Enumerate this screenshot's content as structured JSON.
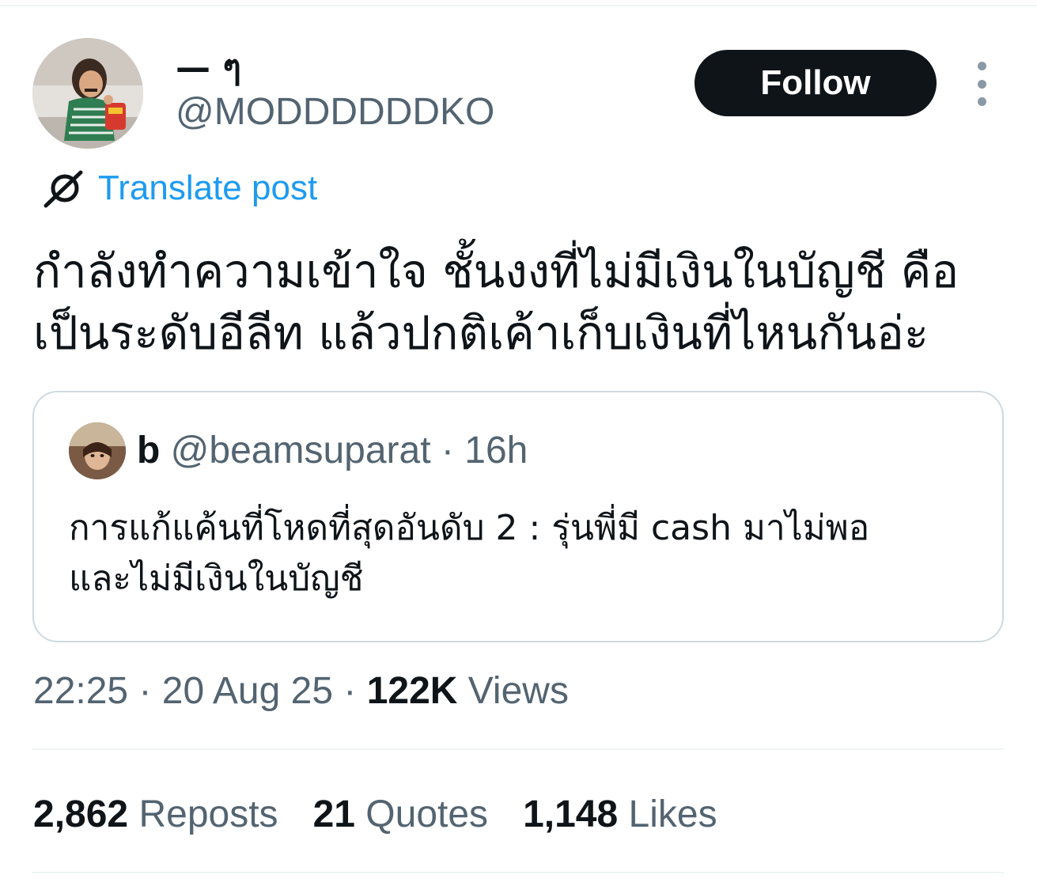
{
  "author": {
    "display_name": "— ๆ",
    "handle": "@MODDDDDDKO"
  },
  "actions": {
    "follow_label": "Follow",
    "more_icon": "more-vertical-icon"
  },
  "translate": {
    "icon": "globe-slash-icon",
    "label": "Translate post"
  },
  "tweet": {
    "text": "กำลังทำความเข้าใจ ชั้นงงที่ไม่มีเงินในบัญชี คือ\nเป็นระดับอีลีท แล้วปกติเค้าเก็บเงินที่ไหนกันอ่ะ"
  },
  "quote": {
    "name": "b",
    "handle": "@beamsuparat",
    "separator": "·",
    "time": "16h",
    "text": "การแก้แค้นที่โหดที่สุดอันดับ 2 : รุ่นพี่มี cash มาไม่พอ\nและไม่มีเงินในบัญชี"
  },
  "meta": {
    "time": "22:25",
    "separator": "·",
    "date": "20 Aug 25",
    "views_count": "122K",
    "views_label": "Views"
  },
  "stats": [
    {
      "count": "2,862",
      "label": "Reposts"
    },
    {
      "count": "21",
      "label": "Quotes"
    },
    {
      "count": "1,148",
      "label": "Likes"
    }
  ],
  "colors": {
    "text": "#0f1419",
    "secondary": "#536471",
    "link": "#1d9bf0",
    "border": "#cfd9de"
  }
}
